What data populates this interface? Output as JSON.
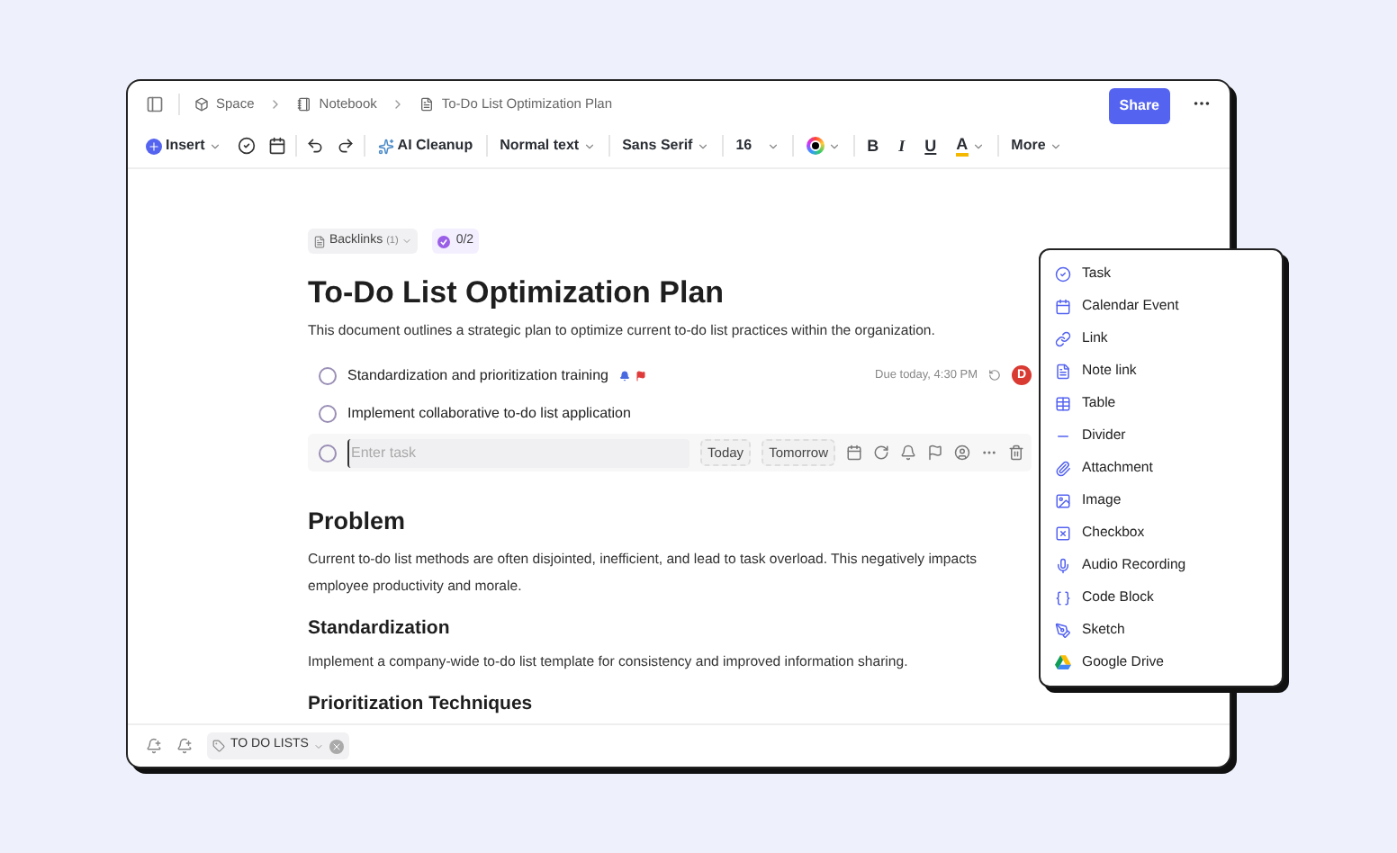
{
  "header": {
    "breadcrumbs": [
      {
        "label": "Space",
        "kind": "space"
      },
      {
        "label": "Notebook",
        "kind": "notebook"
      },
      {
        "label": "To-Do List Optimization Plan",
        "kind": "note"
      }
    ],
    "share": "Share"
  },
  "toolbar": {
    "insert": "Insert",
    "ai_cleanup": "AI Cleanup",
    "text_style": "Normal text",
    "font": "Sans Serif",
    "size": "16",
    "bold": "B",
    "italic": "I",
    "underline": "U",
    "highlight": "A",
    "more": "More"
  },
  "document": {
    "backlinks": {
      "label": "Backlinks",
      "count": "(1)"
    },
    "progress": "0/2",
    "title": "To-Do List Optimization Plan",
    "intro": "This document outlines a strategic plan to optimize current to-do list practices within the organization.",
    "tasks": [
      {
        "label": "Standardization and prioritization training",
        "checked": false,
        "flagged": true,
        "due": "Due today, 4:30 PM",
        "assignee": "D"
      },
      {
        "label": "Implement collaborative to-do list application",
        "checked": false,
        "flagged": false
      }
    ],
    "new_task": {
      "checked": false,
      "placeholder": "Enter task",
      "today": "Today",
      "tomorrow": "Tomorrow"
    },
    "sections": [
      {
        "kind": "h2",
        "text": "Problem"
      },
      {
        "kind": "p",
        "text": "Current to-do list methods are often disjointed, inefficient, and lead to task overload. This negatively impacts employee productivity and morale."
      },
      {
        "kind": "h3",
        "text": "Standardization"
      },
      {
        "kind": "p",
        "text": "Implement a company-wide to-do list template for consistency and improved information sharing."
      },
      {
        "kind": "h3",
        "text": "Prioritization Techniques"
      }
    ]
  },
  "footer": {
    "tag": "TO DO LISTS"
  },
  "insert_menu": {
    "items": [
      {
        "label": "Task",
        "kind": "task"
      },
      {
        "label": "Calendar Event",
        "kind": "calendar"
      },
      {
        "label": "Link",
        "kind": "link"
      },
      {
        "label": "Note link",
        "kind": "note"
      },
      {
        "label": "Table",
        "kind": "table"
      },
      {
        "label": "Divider",
        "kind": "divider"
      },
      {
        "label": "Attachment",
        "kind": "attachment"
      },
      {
        "label": "Image",
        "kind": "image"
      },
      {
        "label": "Checkbox",
        "kind": "checkbox"
      },
      {
        "label": "Audio Recording",
        "kind": "audio"
      },
      {
        "label": "Code Block",
        "kind": "code"
      },
      {
        "label": "Sketch",
        "kind": "sketch"
      },
      {
        "label": "Google Drive",
        "kind": "drive"
      }
    ]
  }
}
